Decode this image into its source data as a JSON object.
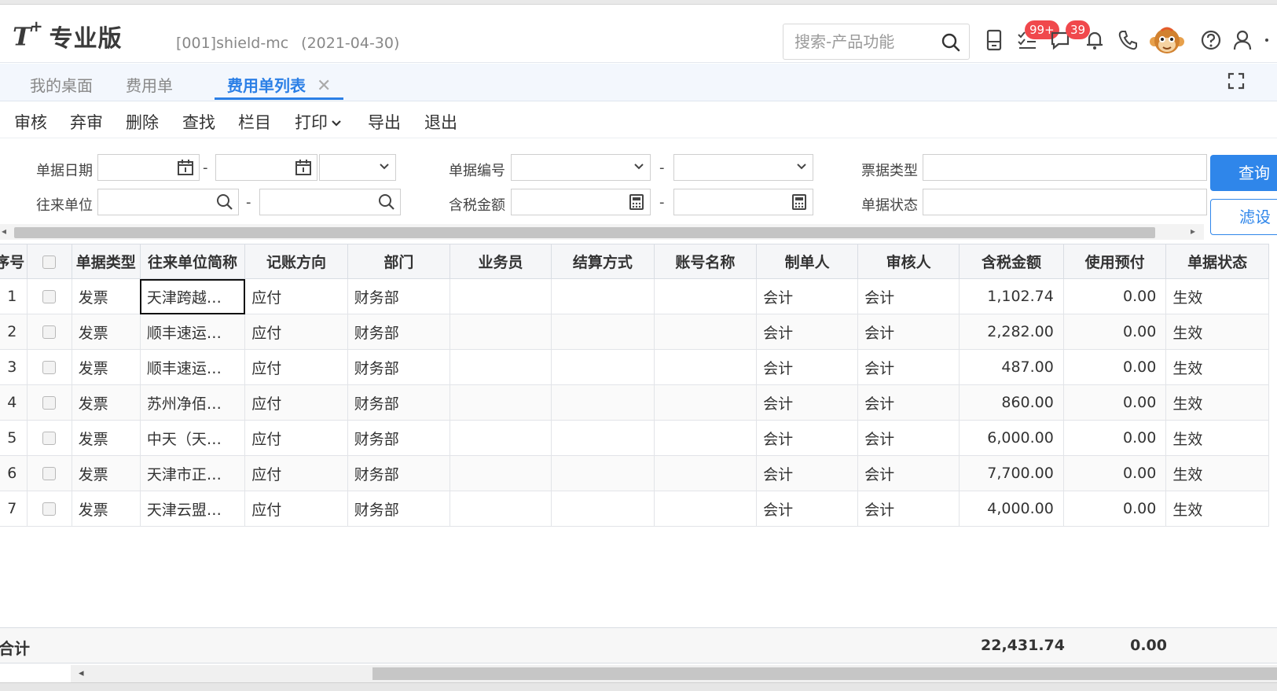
{
  "header": {
    "logo_main": "T",
    "logo_plus": "+",
    "edition": "专业版",
    "account": "[001]shield-mc",
    "account_date": "(2021-04-30)",
    "search_placeholder": "搜索-产品功能",
    "badges": {
      "tasks": "99+",
      "messages": "39"
    }
  },
  "tabs": [
    {
      "label": "我的桌面"
    },
    {
      "label": "费用单"
    },
    {
      "label": "费用单列表",
      "close": "✕"
    }
  ],
  "toolbar": {
    "audit": "审核",
    "unaudit": "弃审",
    "delete": "删除",
    "find": "查找",
    "columns": "栏目",
    "print": "打印",
    "export": "导出",
    "exit": "退出"
  },
  "filter": {
    "bill_date": "单据日期",
    "bill_no": "单据编号",
    "ticket_type": "票据类型",
    "partner": "往来单位",
    "tax_amount": "含税金额",
    "bill_status": "单据状态",
    "dash": "-",
    "query": "查询",
    "filter_btn": "滤设"
  },
  "grid": {
    "columns": [
      "序号",
      "",
      "单据类型",
      "往来单位简称",
      "记账方向",
      "部门",
      "业务员",
      "结算方式",
      "账号名称",
      "制单人",
      "审核人",
      "含税金额",
      "使用预付",
      "单据状态"
    ],
    "rows": [
      [
        "1",
        "发票",
        "天津跨越…",
        "应付",
        "财务部",
        "",
        "",
        "",
        "会计",
        "会计",
        "1,102.74",
        "0.00",
        "生效"
      ],
      [
        "2",
        "发票",
        "顺丰速运…",
        "应付",
        "财务部",
        "",
        "",
        "",
        "会计",
        "会计",
        "2,282.00",
        "0.00",
        "生效"
      ],
      [
        "3",
        "发票",
        "顺丰速运…",
        "应付",
        "财务部",
        "",
        "",
        "",
        "会计",
        "会计",
        "487.00",
        "0.00",
        "生效"
      ],
      [
        "4",
        "发票",
        "苏州净佰…",
        "应付",
        "财务部",
        "",
        "",
        "",
        "会计",
        "会计",
        "860.00",
        "0.00",
        "生效"
      ],
      [
        "5",
        "发票",
        "中天（天…",
        "应付",
        "财务部",
        "",
        "",
        "",
        "会计",
        "会计",
        "6,000.00",
        "0.00",
        "生效"
      ],
      [
        "6",
        "发票",
        "天津市正…",
        "应付",
        "财务部",
        "",
        "",
        "",
        "会计",
        "会计",
        "7,700.00",
        "0.00",
        "生效"
      ],
      [
        "7",
        "发票",
        "天津云盟…",
        "应付",
        "财务部",
        "",
        "",
        "",
        "会计",
        "会计",
        "4,000.00",
        "0.00",
        "生效"
      ]
    ]
  },
  "totals": {
    "label": "合计",
    "tax_amount": "22,431.74",
    "prepay": "0.00"
  },
  "colors": {
    "accent": "#2b7fe6",
    "badge": "#f0484c"
  }
}
